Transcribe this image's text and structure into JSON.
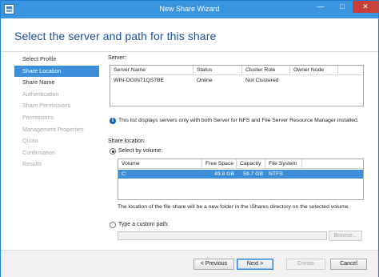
{
  "window": {
    "title": "New Share Wizard",
    "minimize_glyph": "—",
    "maximize_glyph": "□",
    "close_glyph": "✕"
  },
  "header": {
    "title": "Select the server and path for this share"
  },
  "nav": {
    "items": [
      {
        "label": "Select Profile",
        "state": "normal"
      },
      {
        "label": "Share Location",
        "state": "selected"
      },
      {
        "label": "Share Name",
        "state": "normal"
      },
      {
        "label": "Authentication",
        "state": "disabled"
      },
      {
        "label": "Share Permissions",
        "state": "disabled"
      },
      {
        "label": "Permissions",
        "state": "disabled"
      },
      {
        "label": "Management Properties",
        "state": "disabled"
      },
      {
        "label": "Quota",
        "state": "disabled"
      },
      {
        "label": "Confirmation",
        "state": "disabled"
      },
      {
        "label": "Results",
        "state": "disabled"
      }
    ]
  },
  "server": {
    "label": "Server:",
    "columns": [
      "Server Name",
      "Status",
      "Cluster Role",
      "Owner Node"
    ],
    "rows": [
      [
        "WIN-OGIN71QS7BE",
        "Online",
        "Not Clustered",
        ""
      ]
    ],
    "info": "This list displays servers only with both Server for NFS and File Server Resource Manager installed."
  },
  "share_location": {
    "label": "Share location:",
    "select_by_volume_label": "Select by volume:",
    "volume_columns": [
      "Volume",
      "Free Space",
      "Capacity",
      "File System"
    ],
    "volume_rows": [
      [
        "C:",
        "49.8 GB",
        "59.7 GB",
        "NTFS"
      ]
    ],
    "note": "The location of the file share will be a new folder in the \\Shares directory on the selected volume.",
    "custom_path_label": "Type a custom path:",
    "custom_path_value": "",
    "browse_label": "Browse..."
  },
  "footer": {
    "previous_label": "< Previous",
    "next_label": "Next >",
    "create_label": "Create",
    "cancel_label": "Cancel"
  },
  "colors": {
    "title_bar": "#3b94de",
    "selection": "#3c8ed8",
    "heading": "#1b4f9c",
    "close_button": "#c8413b"
  }
}
